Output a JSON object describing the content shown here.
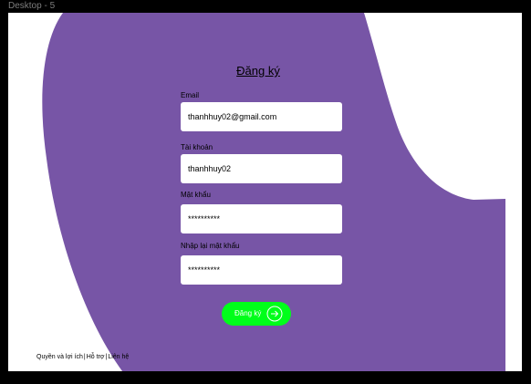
{
  "frame": {
    "label": "Desktop - 5"
  },
  "colors": {
    "purple": "#7755a6",
    "accent_green": "#00ff1a",
    "page_bg": "#ffffff",
    "outer_bg": "#000000"
  },
  "form": {
    "title": "Đăng ký",
    "fields": [
      {
        "label": "Email",
        "value": "thanhhuy02@gmail.com"
      },
      {
        "label": "Tài khoản",
        "value": "thanhhuy02"
      },
      {
        "label": "Mật khẩu",
        "value": "**********"
      },
      {
        "label": "Nhập lại mật khẩu",
        "value": "**********"
      }
    ],
    "submit": {
      "label": "Đăng ký",
      "icon": "arrow-right-circle-icon"
    }
  },
  "footer": {
    "links": [
      "Quyền và lợi ích",
      "Hỗ trợ",
      "Liên hệ"
    ],
    "separator": "|"
  }
}
